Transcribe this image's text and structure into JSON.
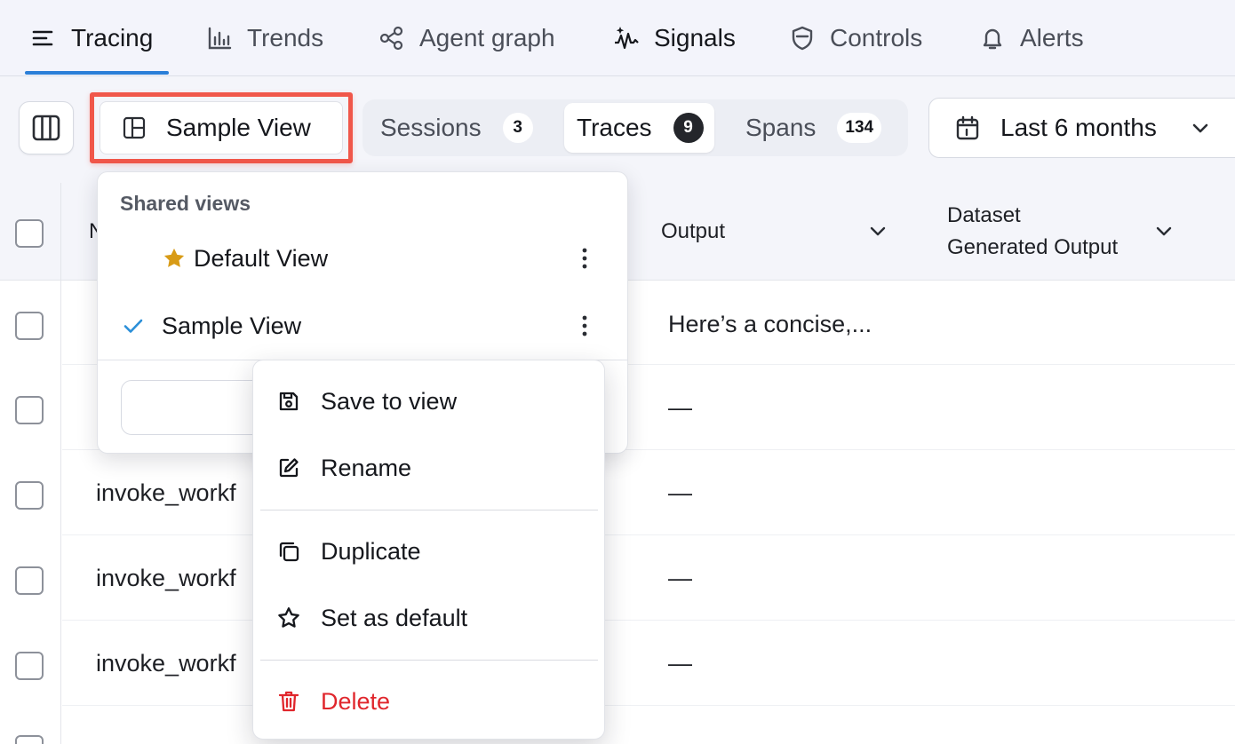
{
  "nav": {
    "items": [
      {
        "label": "Tracing",
        "icon": "menu-lines-icon",
        "active": true
      },
      {
        "label": "Trends",
        "icon": "bar-chart-icon"
      },
      {
        "label": "Agent graph",
        "icon": "graph-nodes-icon"
      },
      {
        "label": "Signals",
        "icon": "sparkle-wave-icon"
      },
      {
        "label": "Controls",
        "icon": "shield-icon"
      },
      {
        "label": "Alerts",
        "icon": "bell-icon"
      }
    ]
  },
  "toolbar": {
    "view_label": "Sample View",
    "tabs": [
      {
        "label": "Sessions",
        "count": "3"
      },
      {
        "label": "Traces",
        "count": "9",
        "active": true
      },
      {
        "label": "Spans",
        "count": "134"
      }
    ],
    "date_range": "Last 6 months"
  },
  "table": {
    "headers": {
      "name": "N",
      "output": "Output",
      "dataset_line1": "Dataset",
      "dataset_line2": "Generated Output"
    },
    "rows": [
      {
        "name": "",
        "output": "Here’s a concise,..."
      },
      {
        "name": "",
        "output": "—"
      },
      {
        "name": "invoke_workf",
        "output": "—"
      },
      {
        "name": "invoke_workf",
        "output": "—"
      },
      {
        "name": "invoke_workf",
        "output": "—"
      }
    ]
  },
  "views_menu": {
    "header": "Shared views",
    "items": [
      {
        "label": "Default View",
        "icon": "star-filled-icon",
        "default": true
      },
      {
        "label": "Sample View",
        "icon": "check-icon",
        "selected": true
      }
    ]
  },
  "context_menu": {
    "items": [
      {
        "label": "Save to view",
        "icon": "save-icon"
      },
      {
        "label": "Rename",
        "icon": "pencil-icon"
      },
      {
        "label": "Duplicate",
        "icon": "copy-icon"
      },
      {
        "label": "Set as default",
        "icon": "star-outline-icon"
      },
      {
        "label": "Delete",
        "icon": "trash-icon",
        "danger": true
      }
    ]
  },
  "colors": {
    "accent": "#2b7fd8",
    "highlight": "#f0574a",
    "danger": "#e0262c",
    "star": "#d89b16"
  }
}
